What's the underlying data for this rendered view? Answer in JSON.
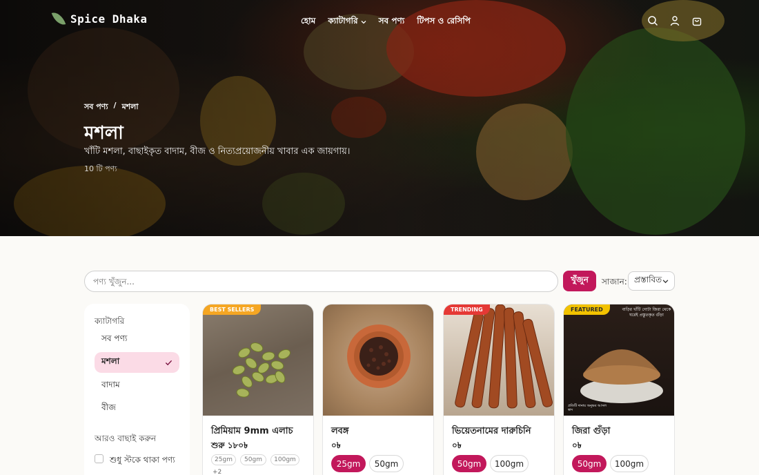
{
  "brand": {
    "name": "Spice Dhaka"
  },
  "nav": {
    "items": [
      {
        "label": "হোম"
      },
      {
        "label": "ক্যাটাগরি",
        "has_dropdown": true
      },
      {
        "label": "সব পণ্য"
      },
      {
        "label": "টিপস ও রেসিপি"
      }
    ],
    "icons": [
      "search-icon",
      "user-icon",
      "cart-icon"
    ]
  },
  "hero": {
    "breadcrumb": [
      "সব পণ্য",
      "/",
      "মশলা"
    ],
    "title": "মশলা",
    "subtitle": "খাঁটি মশলা, বাছাইকৃত বাদাম, বীজ ও নিত্যপ্রয়োজনীয় খাবার এক জায়গায়।",
    "count": "10 টি পণ্য"
  },
  "search": {
    "placeholder": "পণ্য খুঁজুন...",
    "button": "খুঁজুন"
  },
  "sort": {
    "label": "সাজান:",
    "selected": "প্রস্তাবিত"
  },
  "sidebar": {
    "heading": "ক্যাটাগরি",
    "items": [
      {
        "label": "সব পণ্য",
        "active": false
      },
      {
        "label": "মশলা",
        "active": true
      },
      {
        "label": "বাদাম",
        "active": false
      },
      {
        "label": "বীজ",
        "active": false
      }
    ],
    "filter_heading": "আরও বাছাই করুন",
    "filter_in_stock": "শুধু স্টকে থাকা পণ্য"
  },
  "products": [
    {
      "badge": "BEST SELLERS",
      "badge_color": "#f5a623",
      "name": "প্রিমিয়াম 9mm এলাচ",
      "price": "শুরু ১৮০৳",
      "options": [
        "25gm",
        "50gm",
        "100gm"
      ],
      "more": "+2"
    },
    {
      "badge": "",
      "name": "লবঙ্গ",
      "price": "০৳",
      "options": [
        "25gm",
        "50gm"
      ]
    },
    {
      "badge": "TRENDING",
      "badge_color": "#e53935",
      "name": "ভিয়েতনামের দারুচিনি",
      "price": "০৳",
      "options": [
        "50gm",
        "100gm"
      ]
    },
    {
      "badge": "FEATURED",
      "badge_color": "#f2c200",
      "name": "জিরা গুঁড়া",
      "price": "০৳",
      "options": [
        "50gm",
        "100gm"
      ],
      "img_caption_top": "বাড়ির খাঁটি গোটা জিরা থেকে ঘরেই প্রস্তুতকৃত গুঁড়া",
      "img_caption_bottom": "প্রতিটি দানায় অনুভব আসল স্বাদ"
    }
  ],
  "colors": {
    "accent": "#c2185b",
    "accent_light": "#fbdbe6"
  }
}
